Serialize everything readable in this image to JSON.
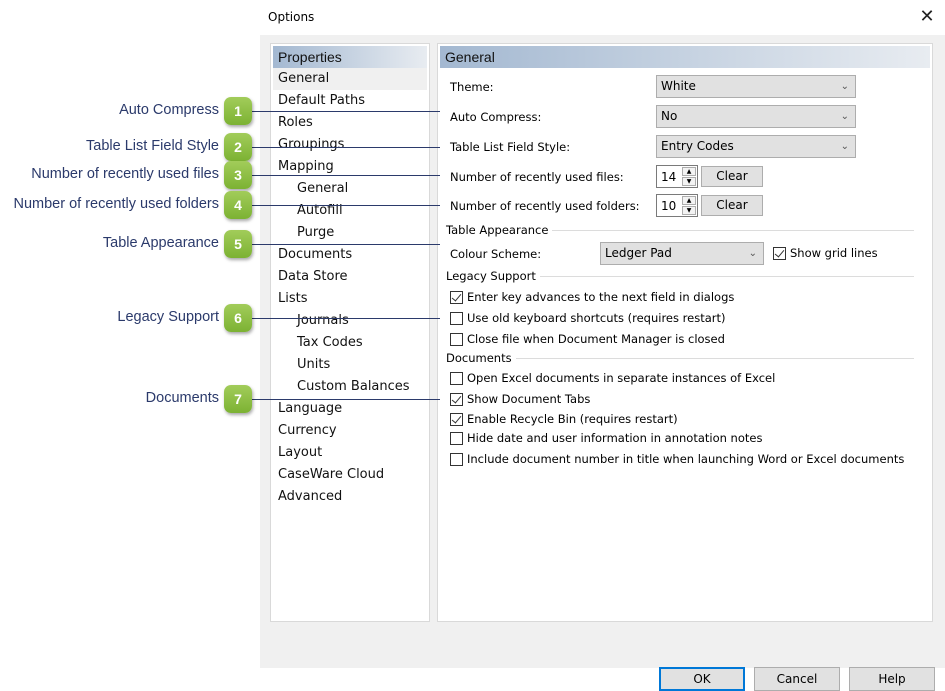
{
  "dialog": {
    "title": "Options",
    "close_icon": "✕"
  },
  "left_panel": {
    "header": "Properties",
    "items": [
      {
        "label": "General",
        "level": 0,
        "selected": true
      },
      {
        "label": "Default Paths",
        "level": 0
      },
      {
        "label": "Roles",
        "level": 0
      },
      {
        "label": "Groupings",
        "level": 0
      },
      {
        "label": "Mapping",
        "level": 0
      },
      {
        "label": "General",
        "level": 1
      },
      {
        "label": "Autofill",
        "level": 1
      },
      {
        "label": "Purge",
        "level": 1
      },
      {
        "label": "Documents",
        "level": 0
      },
      {
        "label": "Data Store",
        "level": 0
      },
      {
        "label": "Lists",
        "level": 0
      },
      {
        "label": "Journals",
        "level": 1
      },
      {
        "label": "Tax Codes",
        "level": 1
      },
      {
        "label": "Units",
        "level": 1
      },
      {
        "label": "Custom Balances",
        "level": 1
      },
      {
        "label": "Language",
        "level": 0
      },
      {
        "label": "Currency",
        "level": 0
      },
      {
        "label": "Layout",
        "level": 0
      },
      {
        "label": "CaseWare Cloud",
        "level": 0
      },
      {
        "label": "Advanced",
        "level": 0
      }
    ]
  },
  "general": {
    "header": "General",
    "theme": {
      "label": "Theme:",
      "value": "White"
    },
    "auto_compress": {
      "label": "Auto Compress:",
      "value": "No"
    },
    "table_list_field_style": {
      "label": "Table List Field Style:",
      "value": "Entry Codes"
    },
    "recent_files": {
      "label": "Number of recently used files:",
      "value": "14",
      "clear_label": "Clear"
    },
    "recent_folders": {
      "label": "Number of recently used folders:",
      "value": "10",
      "clear_label": "Clear"
    },
    "table_appearance": {
      "title": "Table Appearance",
      "colour_scheme_label": "Colour Scheme:",
      "colour_scheme_value": "Ledger Pad",
      "show_grid_lines": {
        "label": "Show grid lines",
        "checked": true
      }
    },
    "legacy_support": {
      "title": "Legacy Support",
      "options": [
        {
          "label": "Enter key advances to the next field in dialogs",
          "checked": true
        },
        {
          "label": "Use old keyboard shortcuts (requires restart)",
          "checked": false
        },
        {
          "label": "Close file when Document Manager is closed",
          "checked": false
        }
      ]
    },
    "documents": {
      "title": "Documents",
      "options": [
        {
          "label": "Open Excel documents in separate instances of Excel",
          "checked": false
        },
        {
          "label": "Show Document Tabs",
          "checked": true
        },
        {
          "label": "Enable Recycle Bin (requires restart)",
          "checked": true
        },
        {
          "label": "Hide date and user information in annotation notes",
          "checked": false
        },
        {
          "label": "Include document number in title when launching Word or Excel documents",
          "checked": false
        }
      ]
    }
  },
  "footer": {
    "ok_label": "OK",
    "cancel_label": "Cancel",
    "help_label": "Help"
  },
  "callouts": [
    {
      "number": "1",
      "label": "Auto Compress"
    },
    {
      "number": "2",
      "label": "Table List Field Style"
    },
    {
      "number": "3",
      "label": "Number of recently used files"
    },
    {
      "number": "4",
      "label": "Number of recently used folders"
    },
    {
      "number": "5",
      "label": "Table Appearance"
    },
    {
      "number": "6",
      "label": "Legacy Support"
    },
    {
      "number": "7",
      "label": "Documents"
    }
  ],
  "colors": {
    "callout_text": "#2b3a6b",
    "badge_green": "#8dbf40",
    "header_gradient_start": "#a3b8d1",
    "default_button_border": "#0078d7"
  }
}
